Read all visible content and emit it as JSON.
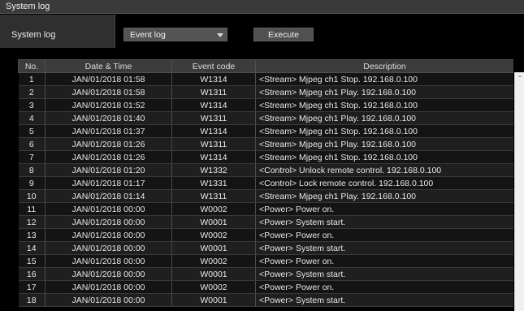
{
  "panel": {
    "title": "System log"
  },
  "controls": {
    "label": "System log",
    "log_type_selected": "Event log",
    "execute_label": "Execute"
  },
  "table": {
    "headers": [
      "No.",
      "Date & Time",
      "Event code",
      "Description"
    ],
    "rows": [
      [
        "1",
        "JAN/01/2018 01:58",
        "W1314",
        "<Stream> Mjpeg ch1 Stop. 192.168.0.100"
      ],
      [
        "2",
        "JAN/01/2018 01:58",
        "W1311",
        "<Stream> Mjpeg ch1 Play. 192.168.0.100"
      ],
      [
        "3",
        "JAN/01/2018 01:52",
        "W1314",
        "<Stream> Mjpeg ch1 Stop. 192.168.0.100"
      ],
      [
        "4",
        "JAN/01/2018 01:40",
        "W1311",
        "<Stream> Mjpeg ch1 Play. 192.168.0.100"
      ],
      [
        "5",
        "JAN/01/2018 01:37",
        "W1314",
        "<Stream> Mjpeg ch1 Stop. 192.168.0.100"
      ],
      [
        "6",
        "JAN/01/2018 01:26",
        "W1311",
        "<Stream> Mjpeg ch1 Play. 192.168.0.100"
      ],
      [
        "7",
        "JAN/01/2018 01:26",
        "W1314",
        "<Stream> Mjpeg ch1 Stop. 192.168.0.100"
      ],
      [
        "8",
        "JAN/01/2018 01:20",
        "W1332",
        "<Control> Unlock remote control. 192.168.0.100"
      ],
      [
        "9",
        "JAN/01/2018 01:17",
        "W1331",
        "<Control> Lock remote control. 192.168.0.100"
      ],
      [
        "10",
        "JAN/01/2018 01:14",
        "W1311",
        "<Stream> Mjpeg ch1 Play. 192.168.0.100"
      ],
      [
        "11",
        "JAN/01/2018 00:00",
        "W0002",
        "<Power> Power on."
      ],
      [
        "12",
        "JAN/01/2018 00:00",
        "W0001",
        "<Power> System start."
      ],
      [
        "13",
        "JAN/01/2018 00:00",
        "W0002",
        "<Power> Power on."
      ],
      [
        "14",
        "JAN/01/2018 00:00",
        "W0001",
        "<Power> System start."
      ],
      [
        "15",
        "JAN/01/2018 00:00",
        "W0002",
        "<Power> Power on."
      ],
      [
        "16",
        "JAN/01/2018 00:00",
        "W0001",
        "<Power> System start."
      ],
      [
        "17",
        "JAN/01/2018 00:00",
        "W0002",
        "<Power> Power on."
      ],
      [
        "18",
        "JAN/01/2018 00:00",
        "W0001",
        "<Power> System start."
      ]
    ]
  },
  "scrollbar": {
    "up_arrow_icon": "chevron-up-icon"
  }
}
